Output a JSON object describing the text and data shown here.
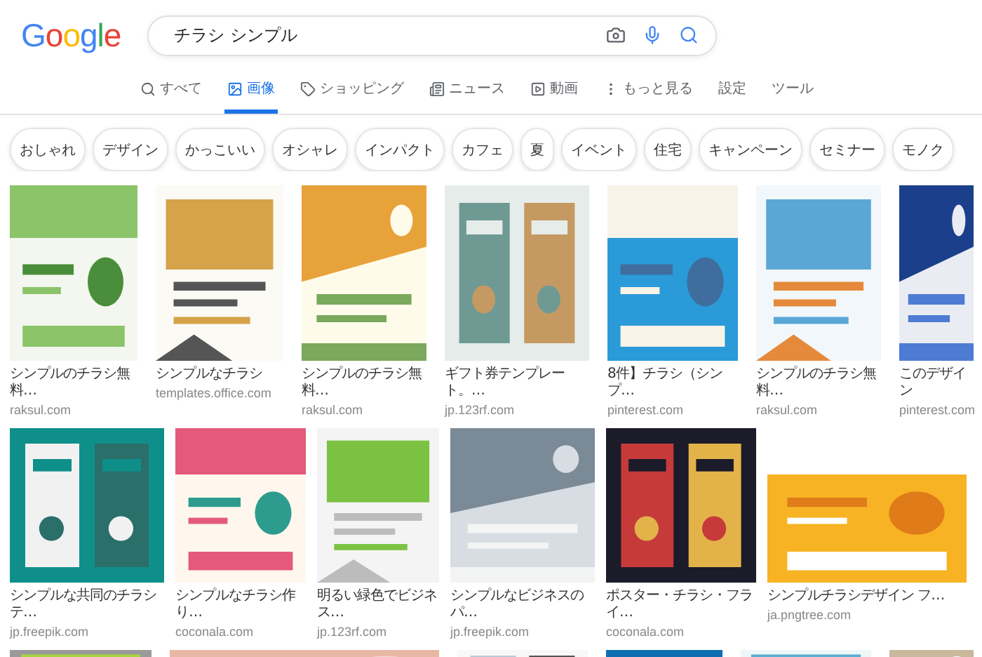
{
  "logo": "Google",
  "search": {
    "value": "チラシ シンプル"
  },
  "tabs": [
    {
      "label": "すべて",
      "selected": false
    },
    {
      "label": "画像",
      "selected": true
    },
    {
      "label": "ショッピング",
      "selected": false
    },
    {
      "label": "ニュース",
      "selected": false
    },
    {
      "label": "動画",
      "selected": false
    },
    {
      "label": "もっと見る",
      "selected": false
    },
    {
      "label": "設定",
      "selected": false
    },
    {
      "label": "ツール",
      "selected": false
    }
  ],
  "chips": [
    "おしゃれ",
    "デザイン",
    "かっこいい",
    "オシャレ",
    "インパクト",
    "カフェ",
    "夏",
    "イベント",
    "住宅",
    "キャンペーン",
    "セミナー",
    "モノク"
  ],
  "rows": [
    [
      {
        "caption": "シンプルのチラシ無料…",
        "source": "raksul.com"
      },
      {
        "caption": "シンプルなチラシ",
        "source": "templates.office.com"
      },
      {
        "caption": "シンプルのチラシ無料…",
        "source": "raksul.com"
      },
      {
        "caption": "ギフト券テンプレート。…",
        "source": "jp.123rf.com"
      },
      {
        "caption": "8件】チラシ（シンプ…",
        "source": "pinterest.com"
      },
      {
        "caption": "シンプルのチラシ無料…",
        "source": "raksul.com"
      },
      {
        "caption": "このデザイン",
        "source": "pinterest.com"
      }
    ],
    [
      {
        "caption": "シンプルな共同のチラシテ…",
        "source": "jp.freepik.com"
      },
      {
        "caption": "シンプルなチラシ作り…",
        "source": "coconala.com"
      },
      {
        "caption": "明るい緑色でビジネス…",
        "source": "jp.123rf.com"
      },
      {
        "caption": "シンプルなビジネスのパ…",
        "source": "jp.freepik.com"
      },
      {
        "caption": "ポスター・チラシ・フライ…",
        "source": "coconala.com"
      },
      {
        "caption": "シンプルチラシデザイン フ…",
        "source": "ja.pngtree.com"
      }
    ],
    [
      {},
      {},
      {},
      {},
      {},
      {}
    ]
  ]
}
